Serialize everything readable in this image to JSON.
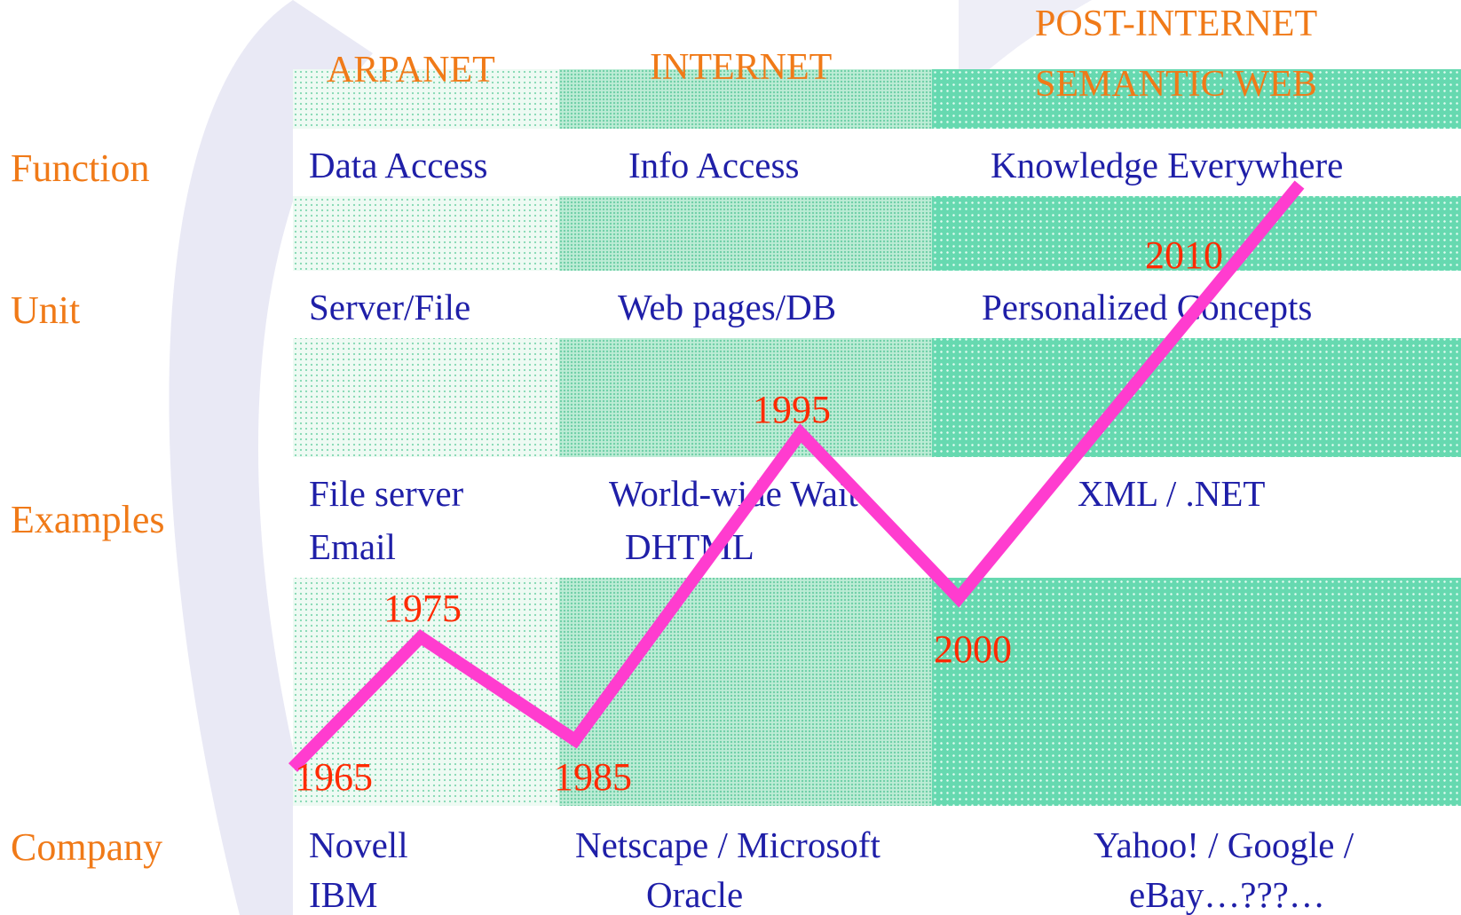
{
  "eras": {
    "arpanet": "ARPANET",
    "internet": "INTERNET",
    "post_line1": "POST-INTERNET",
    "post_line2": "SEMANTIC WEB"
  },
  "rows": {
    "function": "Function",
    "unit": "Unit",
    "examples": "Examples",
    "company": "Company"
  },
  "cells": {
    "function": [
      "Data Access",
      "Info Access",
      "Knowledge Everywhere"
    ],
    "unit": [
      "Server/File",
      "Web pages/DB",
      "Personalized Concepts"
    ],
    "examples": {
      "arpanet": [
        "File server",
        "Email"
      ],
      "internet": [
        "World-wide Wait",
        "DHTML"
      ],
      "post": [
        "XML / .NET"
      ]
    },
    "company": {
      "arpanet": [
        "Novell",
        "IBM"
      ],
      "internet": [
        "Netscape / Microsoft",
        "Oracle"
      ],
      "post": [
        "Yahoo! / Google /",
        "eBay…???…"
      ]
    }
  },
  "timeline": {
    "years": [
      "1965",
      "1975",
      "1985",
      "1995",
      "2000",
      "2010"
    ],
    "line_color": "#ff3ccf",
    "year_color": "#ff2a00"
  },
  "colors": {
    "era_label": "#f07a18",
    "cell_text": "#1f1fa8"
  }
}
